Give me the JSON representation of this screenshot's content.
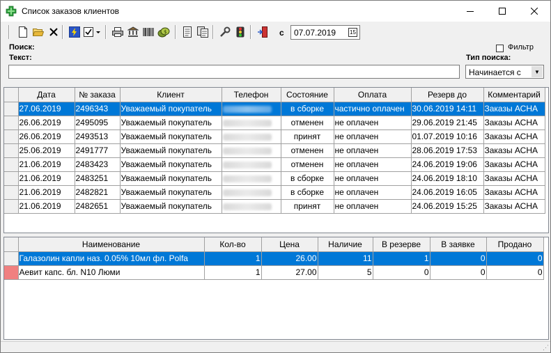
{
  "window": {
    "title": "Список заказов клиентов",
    "colors": {
      "selection": "#0078d7",
      "highlight_indicator": "#f08080"
    }
  },
  "toolbar": {
    "icons": [
      "new-document-icon",
      "open-folder-icon",
      "delete-icon",
      "lightning-icon",
      "checkbox-icon",
      "print-icon",
      "bank-icon",
      "barcode-icon",
      "money-icon",
      "report-icon",
      "copy-report-icon",
      "wrench-icon",
      "traffic-light-icon",
      "exit-door-icon"
    ],
    "date_label": "с",
    "date_value": "07.07.2019"
  },
  "search": {
    "label": "Поиск:",
    "text_label": "Текст:",
    "text_value": "",
    "filter_label": "Фильтр",
    "filter_checked": false,
    "type_label": "Тип поиска:",
    "type_value": "Начинается с"
  },
  "orders": {
    "columns": [
      "Дата",
      "№ заказа",
      "Клиент",
      "Телефон",
      "Состояние",
      "Оплата",
      "Резерв до",
      "Комментарий"
    ],
    "rows": [
      {
        "date": "27.06.2019",
        "num": "2496343",
        "client": "Уважаемый покупатель",
        "status": "в сборке",
        "payment": "частично оплачен",
        "reserve": "30.06.2019 14:11",
        "comment": "Заказы АСНА",
        "selected": true
      },
      {
        "date": "26.06.2019",
        "num": "2495095",
        "client": "Уважаемый покупатель",
        "status": "отменен",
        "payment": "не оплачен",
        "reserve": "29.06.2019 21:45",
        "comment": "Заказы АСНА",
        "selected": false
      },
      {
        "date": "26.06.2019",
        "num": "2493513",
        "client": "Уважаемый покупатель",
        "status": "принят",
        "payment": "не оплачен",
        "reserve": "01.07.2019 10:16",
        "comment": "Заказы АСНА",
        "selected": false
      },
      {
        "date": "25.06.2019",
        "num": "2491777",
        "client": "Уважаемый покупатель",
        "status": "отменен",
        "payment": "не оплачен",
        "reserve": "28.06.2019 17:53",
        "comment": "Заказы АСНА",
        "selected": false
      },
      {
        "date": "21.06.2019",
        "num": "2483423",
        "client": "Уважаемый покупатель",
        "status": "отменен",
        "payment": "не оплачен",
        "reserve": "24.06.2019 19:06",
        "comment": "Заказы АСНА",
        "selected": false
      },
      {
        "date": "21.06.2019",
        "num": "2483251",
        "client": "Уважаемый покупатель",
        "status": "в сборке",
        "payment": "не оплачен",
        "reserve": "24.06.2019 18:10",
        "comment": "Заказы АСНА",
        "selected": false
      },
      {
        "date": "21.06.2019",
        "num": "2482821",
        "client": "Уважаемый покупатель",
        "status": "в сборке",
        "payment": "не оплачен",
        "reserve": "24.06.2019 16:05",
        "comment": "Заказы АСНА",
        "selected": false
      },
      {
        "date": "21.06.2019",
        "num": "2482651",
        "client": "Уважаемый покупатель",
        "status": "принят",
        "payment": "не оплачен",
        "reserve": "24.06.2019 15:25",
        "comment": "Заказы АСНА",
        "selected": false
      }
    ]
  },
  "items": {
    "columns": [
      "Наименование",
      "Кол-во",
      "Цена",
      "Наличие",
      "В резерве",
      "В заявке",
      "Продано"
    ],
    "rows": [
      {
        "name": "Галазолин капли наз. 0.05% 10мл фл. Polfa",
        "qty": "1",
        "price": "26.00",
        "stock": "11",
        "reserved": "1",
        "requested": "0",
        "sold": "0",
        "selected": true,
        "flag": false
      },
      {
        "name": "Аевит капс. бл. N10 Люми",
        "qty": "1",
        "price": "27.00",
        "stock": "5",
        "reserved": "0",
        "requested": "0",
        "sold": "0",
        "selected": false,
        "flag": true
      }
    ]
  }
}
